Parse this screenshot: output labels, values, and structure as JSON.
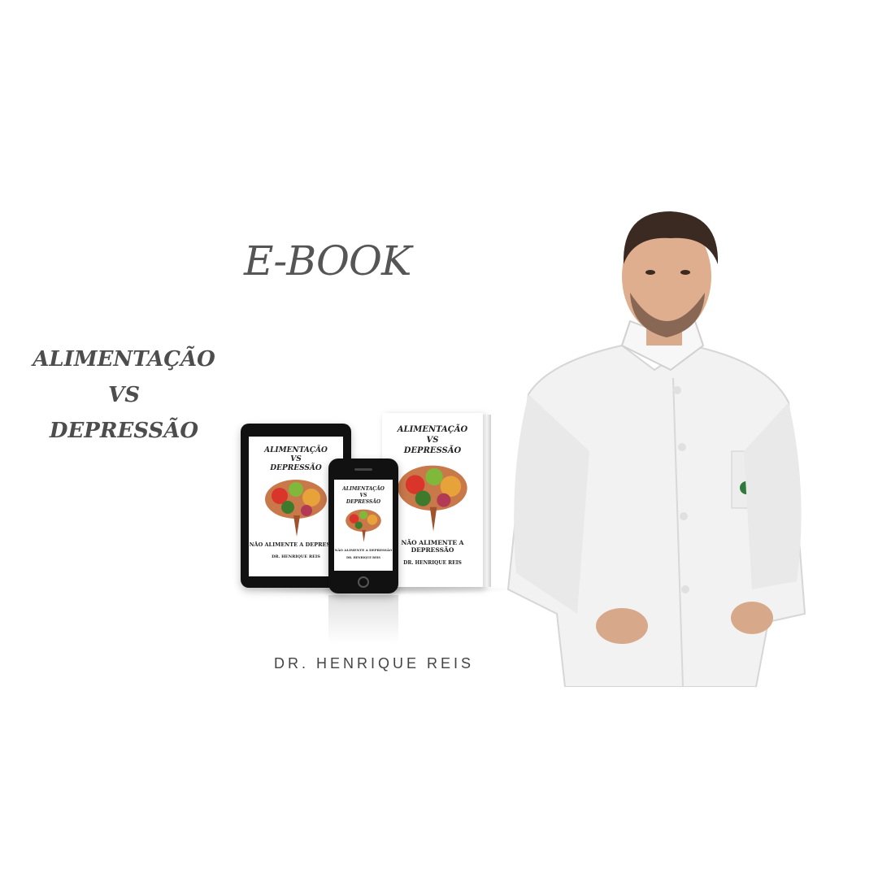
{
  "heading": "E-BOOK",
  "title_lines": [
    "ALIMENTAÇÃO",
    "VS",
    "DEPRESSÃO"
  ],
  "author": "DR. HENRIQUE REIS",
  "cover": {
    "title_lines": [
      "ALIMENTAÇÃO",
      "VS",
      "DEPRESSÃO"
    ],
    "subtitle": "NÃO ALIMENTE A DEPRESSÃO",
    "author": "DR. HENRIQUE REIS"
  },
  "colors": {
    "background": "#ffffff",
    "text": "#4d4d4d",
    "coat": "#f2f2f2"
  }
}
